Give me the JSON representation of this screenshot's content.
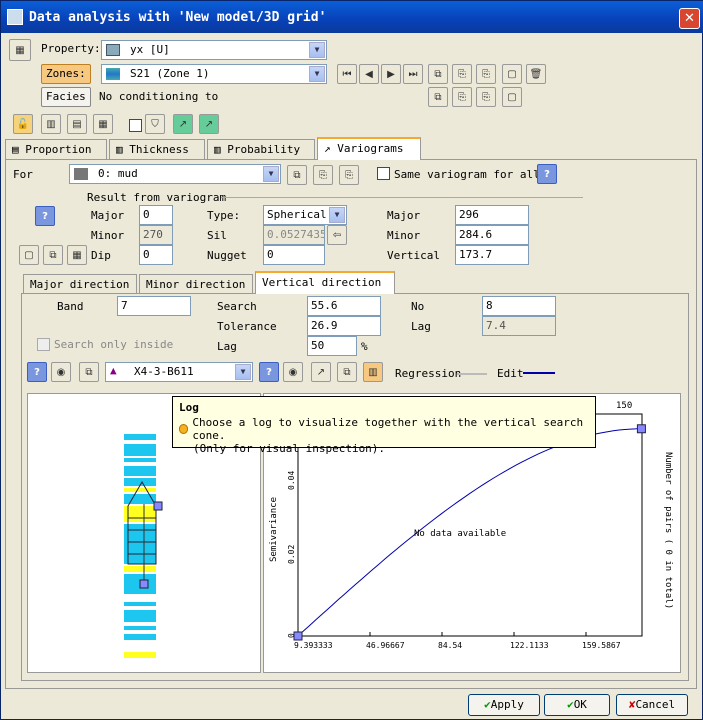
{
  "window": {
    "title": "Data analysis with 'New model/3D grid'",
    "close": "✕"
  },
  "property": {
    "label": "Property:",
    "value": "yx [U]"
  },
  "zones": {
    "label": "Zones:",
    "value": "S21 (Zone 1)"
  },
  "facies": {
    "label": "Facies",
    "value": "No conditioning to"
  },
  "tabs": {
    "proportion": "Proportion",
    "thickness": "Thickness",
    "probability": "Probability",
    "variograms": "Variograms"
  },
  "for": {
    "label": "For",
    "value": "0: mud",
    "same_label": "Same variogram for all"
  },
  "result": {
    "title": "Result from variogram",
    "major_label": "Major",
    "major_value": "0",
    "minor_label": "Minor",
    "minor_value": "270",
    "dip_label": "Dip",
    "dip_value": "0",
    "type_label": "Type:",
    "type_value": "Spherical",
    "sil_label": "Sil",
    "sil_value": "0.05274356",
    "nugget_label": "Nugget",
    "nugget_value": "0",
    "r_major_label": "Major",
    "r_major_value": "296",
    "r_minor_label": "Minor",
    "r_minor_value": "284.6",
    "r_vertical_label": "Vertical",
    "r_vertical_value": "173.7"
  },
  "dirtabs": {
    "major": "Major direction",
    "minor": "Minor direction",
    "vertical": "Vertical direction"
  },
  "search": {
    "band_label": "Band",
    "band_value": "7",
    "search_label": "Search",
    "search_value": "55.6",
    "no_label": "No",
    "no_value": "8",
    "tol_label": "Tolerance",
    "tol_value": "26.9",
    "lag_label": "Lag",
    "lag_value": "7.4",
    "lag2_label": "Lag",
    "lag2_value": "50",
    "pct": "%",
    "only_inside": "Search only inside"
  },
  "well": {
    "value": "X4-3-B611",
    "regression": "Regression",
    "edit": "Edit"
  },
  "tooltip": {
    "title": "Log",
    "line1": "Choose a log to visualize together with the vertical search cone.",
    "line2": "(Only for visual inspection)."
  },
  "chart_data": {
    "type": "line",
    "ylabel": "Semivariance",
    "y2label": "Number of pairs   ( 0 in total)",
    "annotation": "No data available",
    "x_ticks": [
      "9.393333",
      "46.96667",
      "84.54",
      "122.1133",
      "159.5867"
    ],
    "y_ticks": [
      "0",
      "0.02",
      "0.04"
    ],
    "top_tick": "150",
    "series": [
      {
        "x": [
          0,
          173.7
        ],
        "y": [
          0,
          0.05274356
        ]
      }
    ]
  },
  "buttons": {
    "apply": "Apply",
    "ok": "OK",
    "cancel": "Cancel"
  },
  "colors": {
    "accent": "#f6a830",
    "title": "#0a5fd8",
    "curve": "#0000aa"
  }
}
